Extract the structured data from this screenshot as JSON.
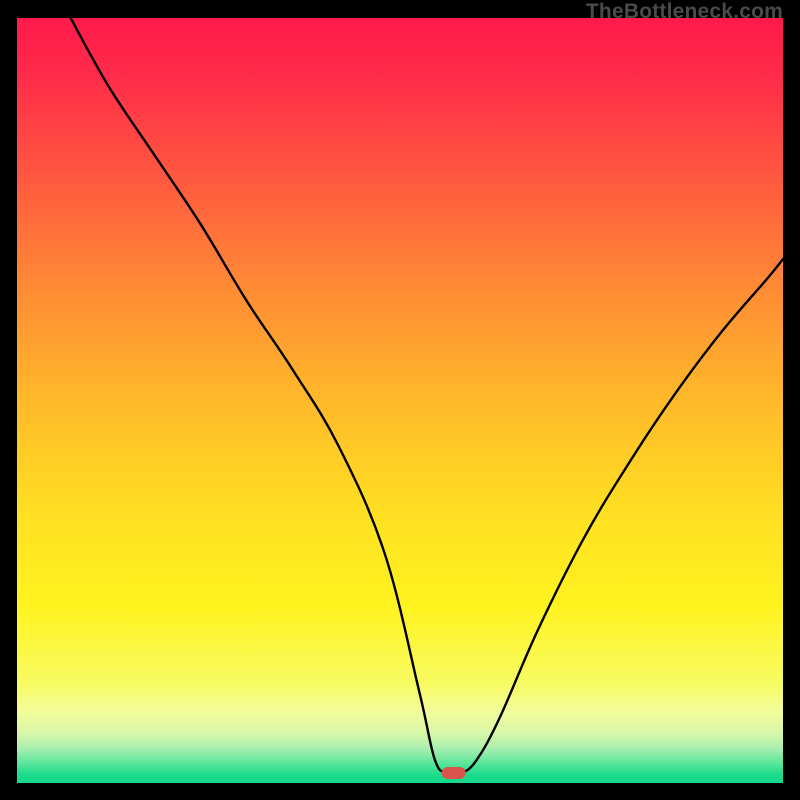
{
  "watermark": "TheBottleneck.com",
  "colors": {
    "background": "#000000",
    "curve_stroke": "#000000",
    "marker_fill": "#d9544d",
    "gradient_stops": [
      {
        "offset": 0.0,
        "color": "#ff1a4b"
      },
      {
        "offset": 0.07,
        "color": "#ff2a4a"
      },
      {
        "offset": 0.2,
        "color": "#ff5540"
      },
      {
        "offset": 0.35,
        "color": "#ff8a35"
      },
      {
        "offset": 0.5,
        "color": "#ffb92a"
      },
      {
        "offset": 0.65,
        "color": "#ffe022"
      },
      {
        "offset": 0.77,
        "color": "#fff31f"
      },
      {
        "offset": 0.87,
        "color": "#f7fb62"
      },
      {
        "offset": 0.905,
        "color": "#f2fd99"
      },
      {
        "offset": 0.935,
        "color": "#d8f7a8"
      },
      {
        "offset": 0.955,
        "color": "#a8efaf"
      },
      {
        "offset": 0.975,
        "color": "#58e59b"
      },
      {
        "offset": 0.99,
        "color": "#17db8a"
      },
      {
        "offset": 1.0,
        "color": "#17db8a"
      }
    ]
  },
  "chart_data": {
    "type": "line",
    "title": "",
    "xlabel": "",
    "ylabel": "",
    "xlim": [
      0,
      100
    ],
    "ylim": [
      0,
      100
    ],
    "grid": false,
    "legend": false,
    "series": [
      {
        "name": "bottleneck-curve",
        "x": [
          7,
          12,
          18,
          24,
          30,
          36,
          42,
          48,
          52.5,
          54.5,
          56,
          58,
          60,
          63,
          68,
          74,
          80,
          86,
          92,
          98,
          100
        ],
        "y": [
          100,
          91,
          82,
          73,
          63,
          54,
          44,
          30,
          12,
          3.2,
          1.3,
          1.3,
          3.0,
          8.5,
          20,
          32,
          42,
          51,
          59,
          66,
          68.5
        ]
      }
    ],
    "marker": {
      "x": 57.0,
      "y": 1.3,
      "shape": "rounded-rect"
    }
  }
}
